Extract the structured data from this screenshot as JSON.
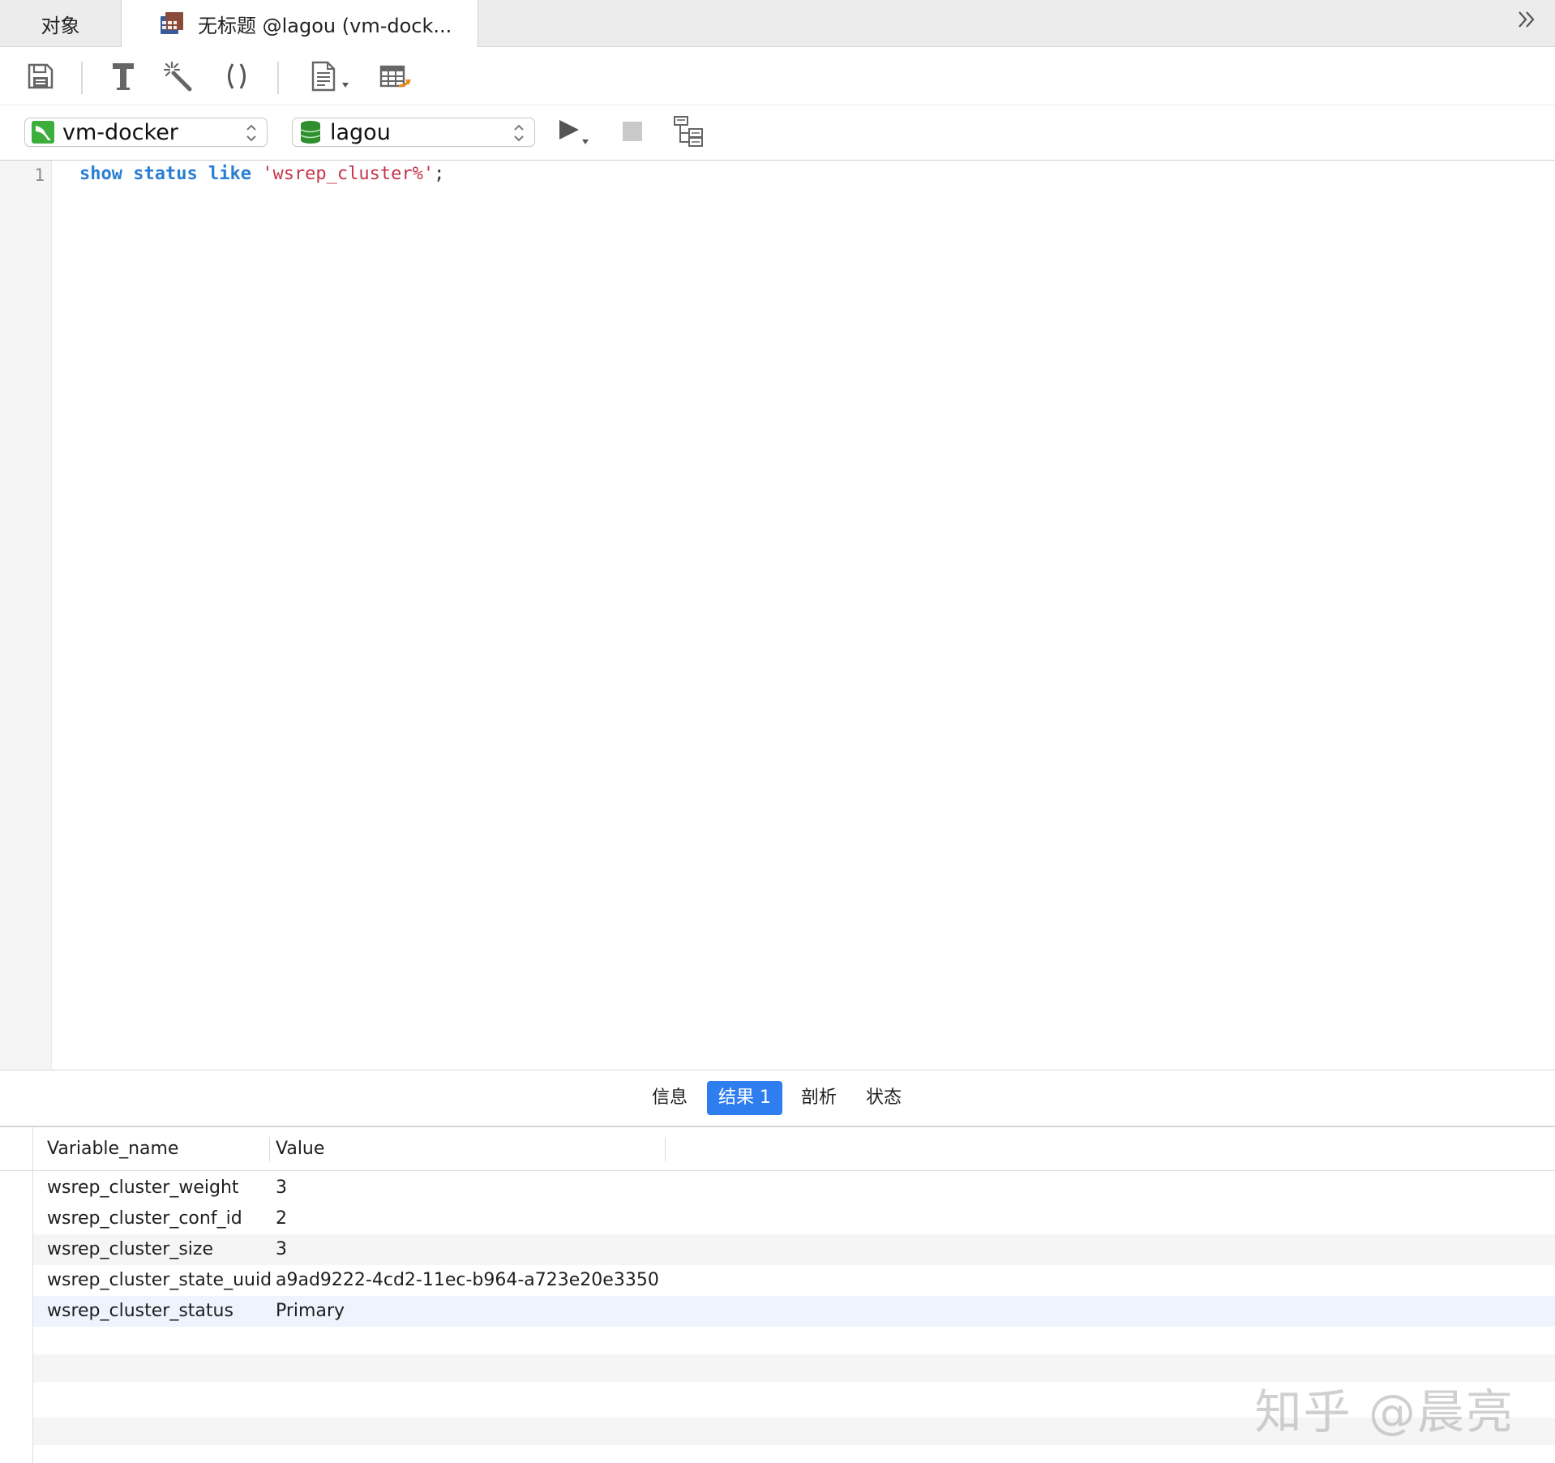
{
  "tabs": {
    "objects_label": "对象",
    "query_label": "无标题 @lagou (vm-dock..."
  },
  "toolbar": {
    "buttons": [
      "save-icon",
      "format-icon",
      "magic-wand-icon",
      "parentheses-icon",
      "document-icon",
      "table-export-icon"
    ]
  },
  "connection": {
    "server": "vm-docker",
    "database": "lagou"
  },
  "editor": {
    "line_number": "1",
    "code": {
      "kw1": "show",
      "kw2": "status",
      "kw3": "like",
      "str": "'wsrep_cluster%'",
      "end": ";"
    }
  },
  "result_tabs": {
    "info": "信息",
    "result1": "结果 1",
    "profile": "剖析",
    "status": "状态"
  },
  "grid": {
    "columns": [
      "Variable_name",
      "Value"
    ],
    "rows": [
      [
        "wsrep_cluster_weight",
        "3"
      ],
      [
        "wsrep_cluster_conf_id",
        "2"
      ],
      [
        "wsrep_cluster_size",
        "3"
      ],
      [
        "wsrep_cluster_state_uuid",
        "a9ad9222-4cd2-11ec-b964-a723e20e3350"
      ],
      [
        "wsrep_cluster_status",
        "Primary"
      ]
    ]
  },
  "watermark": "知乎 @晨亮",
  "colors": {
    "accent": "#2f7ef0",
    "keyword": "#2a7ed3",
    "string": "#c4364a"
  }
}
